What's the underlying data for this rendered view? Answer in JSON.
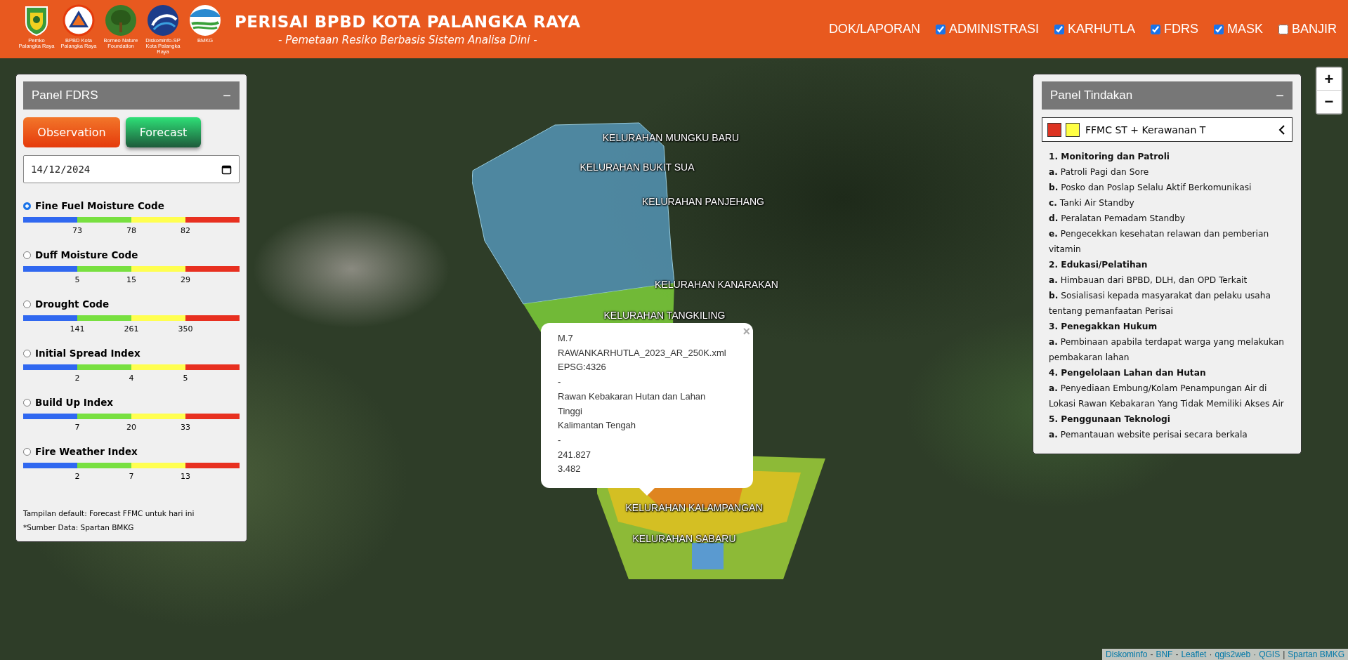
{
  "header": {
    "logos": [
      {
        "kind": "shield",
        "caption": "Pemko Palangka Raya"
      },
      {
        "kind": "triangle",
        "caption": "BPBD Kota Palangka Raya"
      },
      {
        "kind": "tree",
        "caption": "Borneo Nature Foundation"
      },
      {
        "kind": "swirl",
        "caption": "Diskominfo-SP Kota Palangka Raya"
      },
      {
        "kind": "wave",
        "caption": "BMKG"
      }
    ],
    "title": "PERISAI BPBD KOTA PALANGKA RAYA",
    "subtitle": "- Pemetaan Resiko Berbasis Sistem Analisa Dini -",
    "nav": [
      {
        "kind": "link",
        "label": "DOK/LAPORAN"
      },
      {
        "kind": "checkbox",
        "label": "ADMINISTRASI",
        "checked": true
      },
      {
        "kind": "checkbox",
        "label": "KARHUTLA",
        "checked": true
      },
      {
        "kind": "checkbox",
        "label": "FDRS",
        "checked": true
      },
      {
        "kind": "checkbox",
        "label": "MASK",
        "checked": true
      },
      {
        "kind": "checkbox",
        "label": "BANJIR",
        "checked": false
      }
    ]
  },
  "map": {
    "area_labels": [
      "KELURAHAN MUNGKU BARU",
      "KELURAHAN BUKIT SUA",
      "KELURAHAN PANJEHANG",
      "KELURAHAN KANARAKAN",
      "KELURAHAN TANGKILING",
      "KELURAHAN KALAMPANGAN",
      "KELURAHAN SABARU"
    ],
    "zoom_controls": [
      "+",
      "−"
    ],
    "popup": {
      "close": "×",
      "lines": [
        "M.7",
        "RAWANKARHUTLA_2023_AR_250K.xml",
        "EPSG:4326",
        "-",
        "Rawan Kebakaran Hutan dan Lahan Tinggi",
        "Kalimantan Tengah",
        "-",
        "241.827",
        "3.482"
      ]
    },
    "attribution": [
      {
        "label": "Diskominfo"
      },
      {
        "separator": "-",
        "label": "BNF"
      },
      {
        "separator": "-",
        "label": "Leaflet"
      },
      {
        "separator": "·",
        "label": "qgis2web"
      },
      {
        "separator": "·",
        "label": "QGIS"
      },
      {
        "separator": "|",
        "label": "Spartan BMKG"
      }
    ]
  },
  "fdrs_panel": {
    "title": "Panel FDRS",
    "collapse": "−",
    "buttons": [
      {
        "kind": "observation",
        "label": "Observation"
      },
      {
        "kind": "forecast",
        "label": "Forecast"
      }
    ],
    "date": "14/12/2024",
    "indices": [
      {
        "label": "Fine Fuel Moisture Code",
        "selected": true,
        "ticks": [
          "73",
          "78",
          "82"
        ]
      },
      {
        "label": "Duff Moisture Code",
        "selected": false,
        "ticks": [
          "5",
          "15",
          "29"
        ]
      },
      {
        "label": "Drought Code",
        "selected": false,
        "ticks": [
          "141",
          "261",
          "350"
        ]
      },
      {
        "label": "Initial Spread Index",
        "selected": false,
        "ticks": [
          "2",
          "4",
          "5"
        ]
      },
      {
        "label": "Build Up Index",
        "selected": false,
        "ticks": [
          "7",
          "20",
          "33"
        ]
      },
      {
        "label": "Fire Weather Index",
        "selected": false,
        "ticks": [
          "2",
          "7",
          "13"
        ]
      }
    ],
    "notes": [
      "Tampilan default: Forecast FFMC untuk hari ini",
      "*Sumber Data: Spartan BMKG"
    ]
  },
  "action_panel": {
    "title": "Panel Tindakan",
    "collapse": "−",
    "legend": {
      "swatches": [
        {
          "color": "#dd3322"
        },
        {
          "color": "#ffff44"
        }
      ],
      "label": "FFMC ST + Kerawanan T"
    },
    "sections": [
      {
        "heading": "1. Monitoring dan Patroli",
        "items": [
          {
            "marker": "a.",
            "text": "Patroli Pagi dan Sore"
          },
          {
            "marker": "b.",
            "text": "Posko dan Poslap Selalu Aktif Berkomunikasi"
          },
          {
            "marker": "c.",
            "text": "Tanki Air Standby"
          },
          {
            "marker": "d.",
            "text": "Peralatan Pemadam Standby"
          },
          {
            "marker": "e.",
            "text": "Pengecekkan kesehatan relawan dan pemberian vitamin"
          }
        ]
      },
      {
        "heading": "2. Edukasi/Pelatihan",
        "items": [
          {
            "marker": "a.",
            "text": "Himbauan dari BPBD, DLH, dan OPD Terkait"
          },
          {
            "marker": "b.",
            "text": "Sosialisasi kepada masyarakat dan pelaku usaha tentang pemanfaatan Perisai"
          }
        ]
      },
      {
        "heading": "3. Penegakkan Hukum",
        "items": [
          {
            "marker": "a.",
            "text": "Pembinaan apabila terdapat warga yang melakukan pembakaran lahan"
          }
        ]
      },
      {
        "heading": "4. Pengelolaan Lahan dan Hutan",
        "items": [
          {
            "marker": "a.",
            "text": "Penyediaan Embung/Kolam Penampungan Air di Lokasi Rawan Kebakaran Yang Tidak Memiliki Akses Air"
          }
        ]
      },
      {
        "heading": "5. Penggunaan Teknologi",
        "items": [
          {
            "marker": "a.",
            "text": "Pemantauan website perisai secara berkala"
          }
        ]
      }
    ]
  }
}
